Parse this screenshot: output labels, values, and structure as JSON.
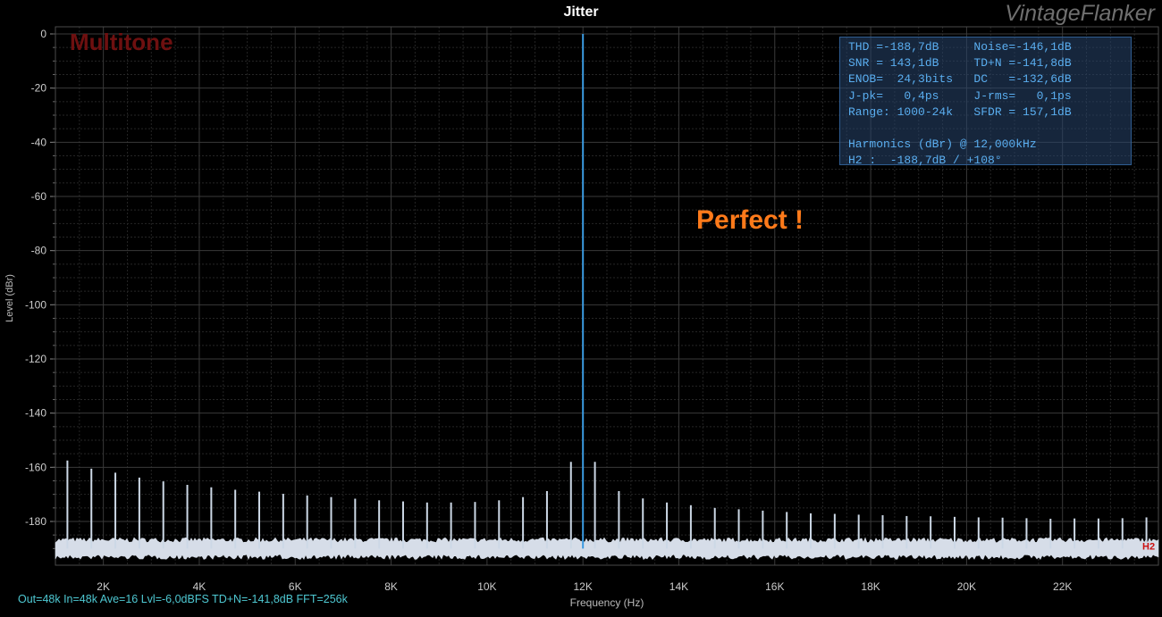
{
  "title": "Jitter",
  "brand": "VintageFlanker",
  "mode_label": "Multitone",
  "annotation": "Perfect !",
  "footer": "Out=48k In=48k Ave=16 Lvl=-6,0dBFS TD+N=-141,8dB FFT=256k",
  "info_box": [
    "THD =-188,7dB     Noise=-146,1dB",
    "SNR = 143,1dB     TD+N =-141,8dB",
    "ENOB=  24,3bits   DC   =-132,6dB",
    "J-pk=   0,4ps     J-rms=   0,1ps",
    "Range: 1000-24k   SFDR = 157,1dB",
    "",
    "Harmonics (dBr) @ 12,000kHz",
    "H2 :  -188,7dB / +108°"
  ],
  "colors": {
    "background": "#000000",
    "grid": "#3a3a3a",
    "main_tone": "#3b9ae0",
    "spurs": "#ccd8e6",
    "noise": "#d6dde8",
    "h2_marker": "#cc1111",
    "annotation": "#ff7a1a",
    "footer": "#4ec8d2"
  },
  "chart_data": {
    "type": "line",
    "title": "Jitter",
    "xlabel": "Frequency (Hz)",
    "ylabel": "Level (dBr)",
    "xlim": [
      1000,
      24000
    ],
    "ylim": [
      -195,
      0
    ],
    "x_ticks": [
      2000,
      4000,
      6000,
      8000,
      10000,
      12000,
      14000,
      16000,
      18000,
      20000,
      22000
    ],
    "x_tick_labels": [
      "2K",
      "4K",
      "6K",
      "8K",
      "10K",
      "12K",
      "14K",
      "16K",
      "18K",
      "20K",
      "22K"
    ],
    "y_ticks": [
      0,
      -20,
      -40,
      -60,
      -80,
      -100,
      -120,
      -140,
      -160,
      -180
    ],
    "y_tick_labels": [
      "0",
      "-20",
      "-40",
      "-60",
      "-80",
      "-100",
      "-120",
      "-140",
      "-160",
      "-180"
    ],
    "grid": true,
    "noise_floor": {
      "level": -190,
      "spread": 4
    },
    "main_tone": {
      "frequency": 12000,
      "level": 0
    },
    "series": [
      {
        "x": [
          1250,
          1750,
          2250,
          2750,
          3250,
          3750,
          4250,
          4750,
          5250,
          5750,
          6250,
          6750,
          7250,
          7750,
          8250,
          8750,
          9250,
          9750,
          10250,
          10750,
          11250,
          11750,
          12250,
          12750,
          13250,
          13750,
          14250,
          14750,
          15250,
          15750,
          16250,
          16750,
          17250,
          17750,
          18250,
          18750,
          19250,
          19750,
          20250,
          20750,
          21250,
          21750,
          22250,
          22750,
          23250,
          23750
        ],
        "y": [
          -157.5,
          -160.5,
          -162,
          -163.8,
          -165.2,
          -166.5,
          -167.4,
          -168.3,
          -169,
          -169.8,
          -170.4,
          -171,
          -171.6,
          -172.2,
          -172.6,
          -173,
          -173,
          -172.8,
          -172.2,
          -171,
          -168.8,
          -158,
          -158,
          -168.8,
          -171.5,
          -173,
          -174,
          -175,
          -175.5,
          -176,
          -176.5,
          -177,
          -177.2,
          -177.5,
          -177.7,
          -178,
          -178.1,
          -178.3,
          -178.5,
          -178.6,
          -178.8,
          -179,
          -178.9,
          -178.9,
          -178.8,
          -178.5
        ]
      }
    ],
    "h2_marker": {
      "label": "H2",
      "frequency": 24000,
      "level": -189
    }
  }
}
